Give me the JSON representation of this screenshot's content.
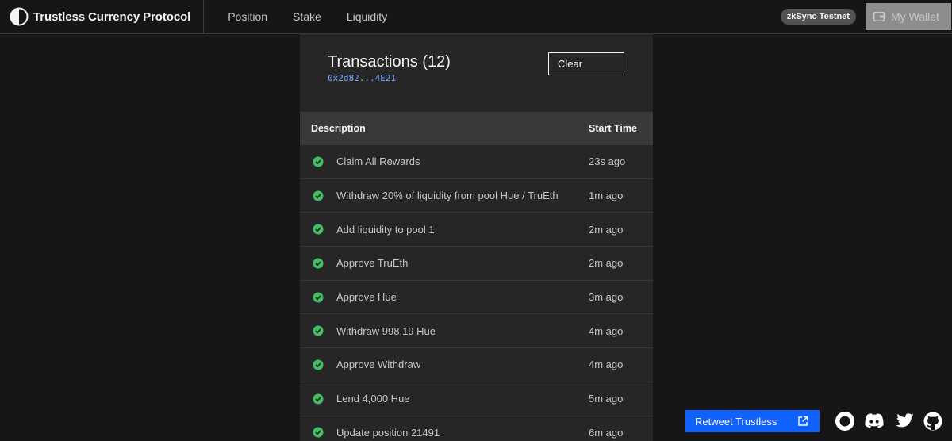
{
  "header": {
    "brand": "Trustless Currency Protocol",
    "nav": [
      "Position",
      "Stake",
      "Liquidity"
    ],
    "network": "zkSync Testnet",
    "wallet_label": "My Wallet"
  },
  "panel": {
    "title": "Transactions (12)",
    "address": "0x2d82...4E21",
    "clear_label": "Clear",
    "columns": [
      "Description",
      "Start Time"
    ],
    "rows": [
      {
        "description": "Claim All Rewards",
        "time": "23s ago"
      },
      {
        "description": "Withdraw 20% of liquidity from pool Hue / TruEth",
        "time": "1m ago"
      },
      {
        "description": "Add liquidity to pool 1",
        "time": "2m ago"
      },
      {
        "description": "Approve TruEth",
        "time": "2m ago"
      },
      {
        "description": "Approve Hue",
        "time": "3m ago"
      },
      {
        "description": "Withdraw 998.19 Hue",
        "time": "4m ago"
      },
      {
        "description": "Approve Withdraw",
        "time": "4m ago"
      },
      {
        "description": "Lend 4,000 Hue",
        "time": "5m ago"
      },
      {
        "description": "Update position 21491",
        "time": "6m ago"
      }
    ]
  },
  "footer": {
    "retweet_label": "Retweet Trustless"
  },
  "colors": {
    "accent": "#0f62fe",
    "success": "#42be65",
    "link": "#78a9ff"
  },
  "icons": [
    "logo-icon",
    "wallet-icon",
    "check-circle-icon",
    "external-link-icon",
    "record-icon",
    "discord-icon",
    "twitter-icon",
    "github-icon"
  ]
}
